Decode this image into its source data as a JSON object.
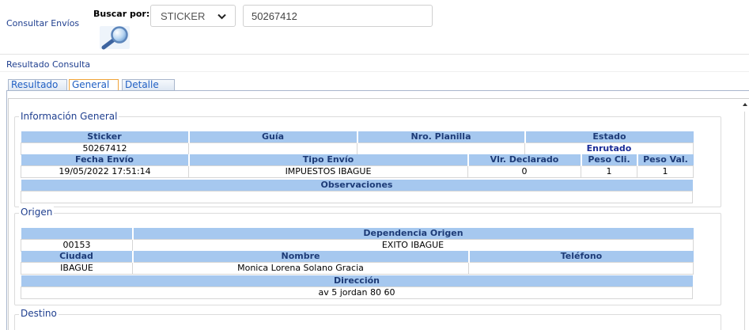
{
  "header": {
    "title": "Consultar Envíos",
    "search_by_label": "Buscar por:",
    "search_by_selected": "STICKER",
    "search_value": "50267412",
    "search_button_icon": "magnifier-icon",
    "dropdown_icon": "chevron-down-icon"
  },
  "results": {
    "title": "Resultado Consulta",
    "tabs": [
      {
        "label": "Resultado",
        "active": false
      },
      {
        "label": "General",
        "active": true
      },
      {
        "label": "Detalle",
        "active": false
      }
    ]
  },
  "general_info": {
    "legend": "Información General",
    "id_headers": [
      "Sticker",
      "Guía",
      "Nro. Planilla",
      "Estado"
    ],
    "id_values": [
      "50267412",
      "",
      "",
      "Enrutado"
    ],
    "shipment_headers": [
      "Fecha Envío",
      "Tipo Envío",
      "Vlr. Declarado",
      "Peso Cli.",
      "Peso Val."
    ],
    "shipment_values": [
      "19/05/2022 17:51:14",
      "IMPUESTOS IBAGUE",
      "0",
      "1",
      "1"
    ],
    "observations_header": "Observaciones",
    "observations_value": ""
  },
  "origin": {
    "legend": "Origen",
    "dependency_headers": [
      "",
      "Dependencia Origen"
    ],
    "dependency_values": [
      "00153",
      "EXITO IBAGUE"
    ],
    "contact_headers": [
      "Ciudad",
      "Nombre",
      "Teléfono"
    ],
    "contact_values": [
      "IBAGUE",
      "Monica Lorena Solano Gracia",
      ""
    ],
    "address_header": "Dirección",
    "address_value": "av 5 jordan 80 60"
  },
  "destination": {
    "legend": "Destino"
  },
  "colors": {
    "link_text": "#1f3f8f",
    "tab_text": "#2160c4",
    "table_header_bg": "#a6c8ef",
    "table_header_text": "#1d3b77",
    "status_text": "#1a2b96",
    "active_tab_border": "#f0a43a"
  }
}
